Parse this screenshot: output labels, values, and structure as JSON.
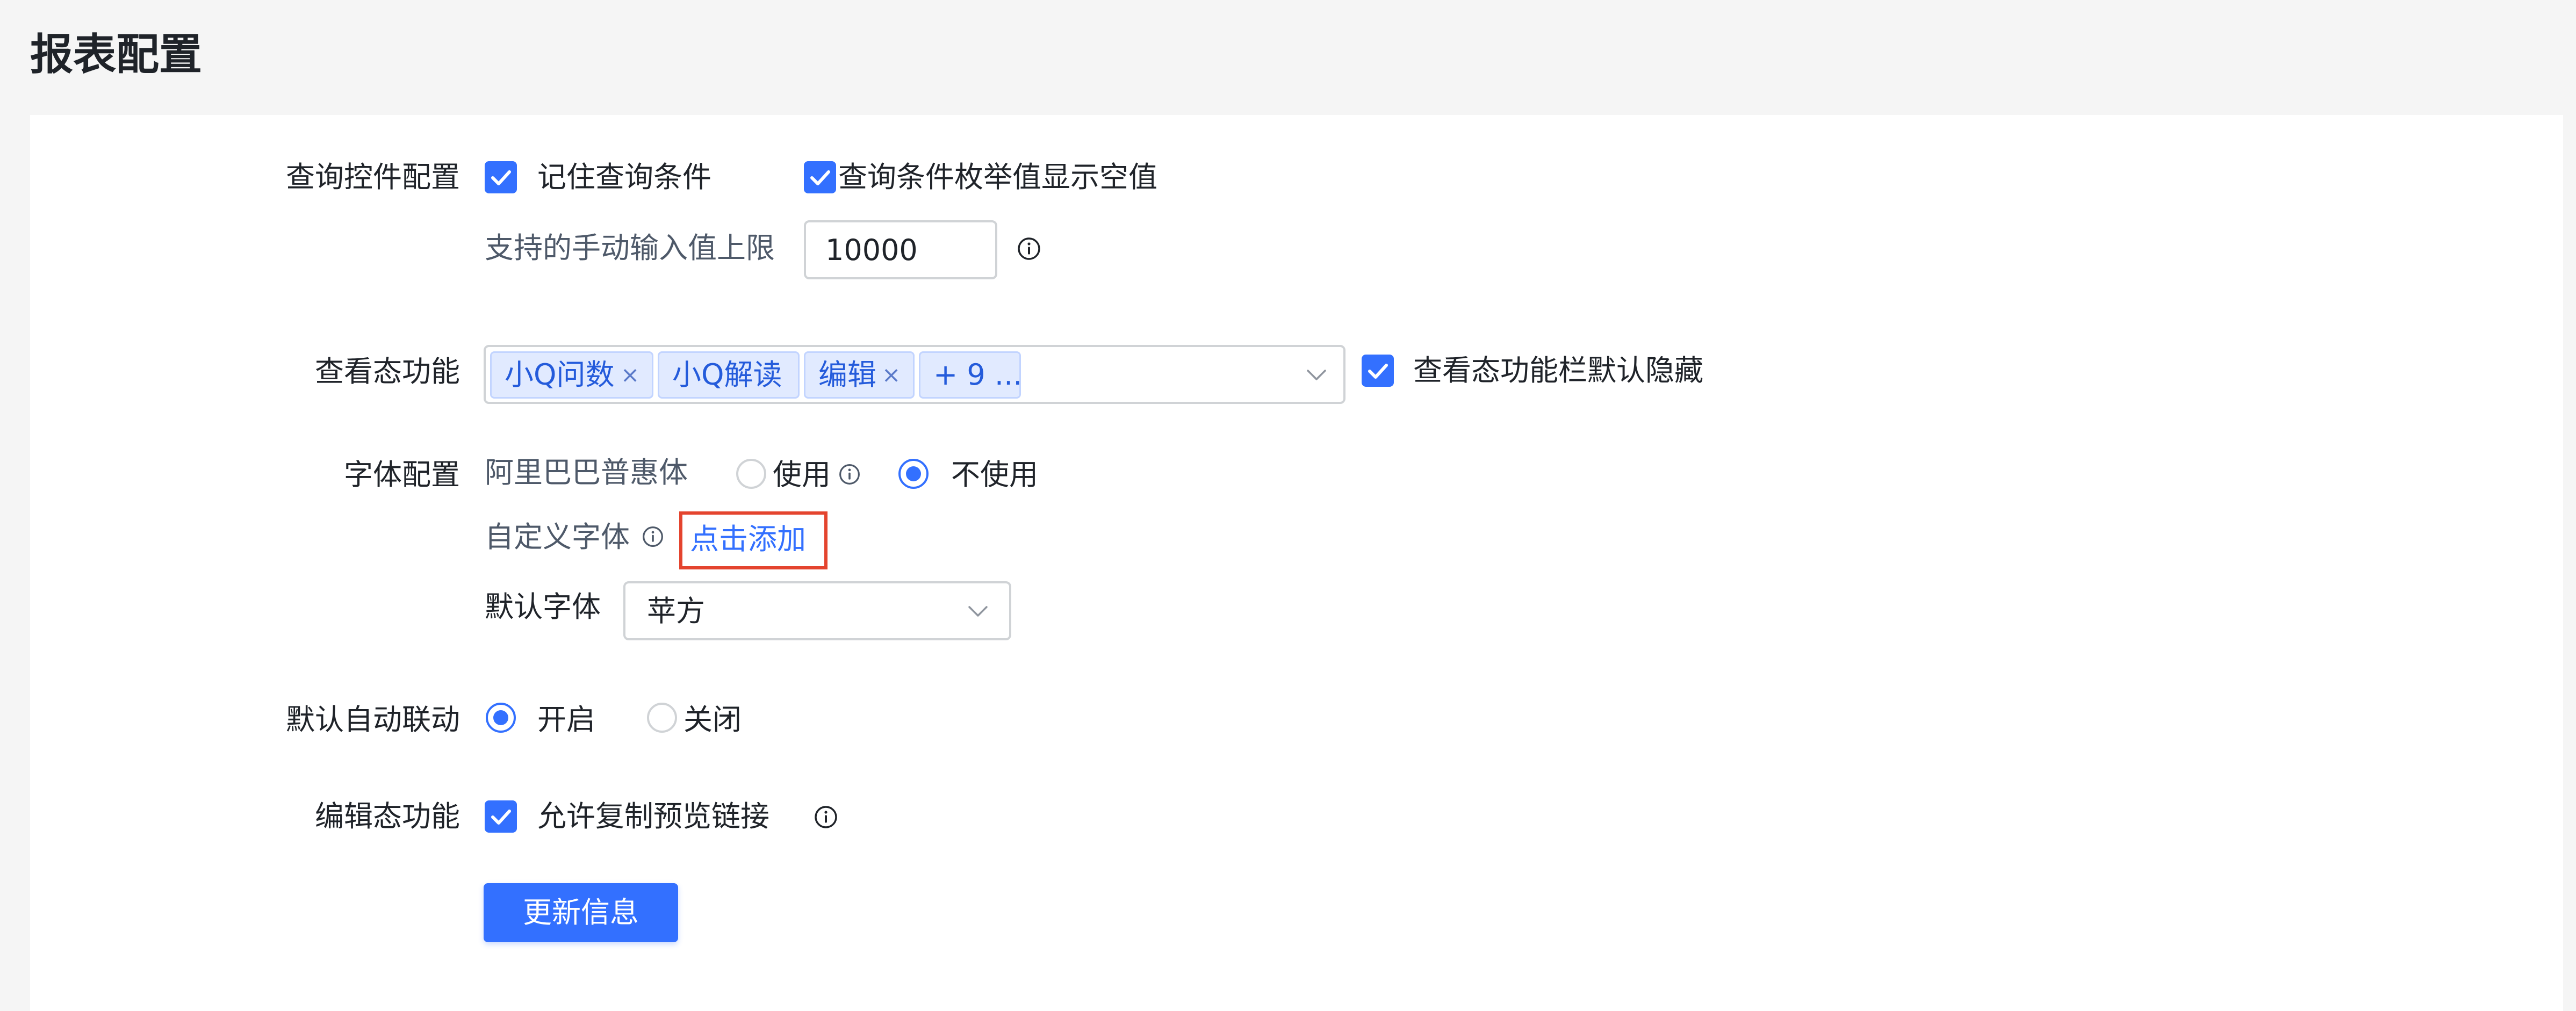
{
  "header": {
    "title": "报表配置"
  },
  "query_controls": {
    "label": "查询控件配置",
    "remember_conditions": {
      "label": "记住查询条件",
      "checked": true
    },
    "show_empty_enum": {
      "label": "查询条件枚举值显示空值",
      "checked": true
    },
    "manual_limit": {
      "label": "支持的手动输入值上限",
      "value": "10000",
      "icon": "info-icon"
    }
  },
  "view_features": {
    "label": "查看态功能",
    "tags": [
      "小Q问数",
      "小Q解读",
      "编辑"
    ],
    "tag_close_glyph": "×",
    "more_tag": "+ 9 ...",
    "hide_toolbar": {
      "label": "查看态功能栏默认隐藏",
      "checked": true
    }
  },
  "font_config": {
    "label": "字体配置",
    "alibaba": {
      "label": "阿里巴巴普惠体",
      "options": [
        "使用",
        "不使用"
      ],
      "selected": "不使用"
    },
    "custom_font": {
      "label": "自定义字体",
      "add_link": "点击添加"
    },
    "default_font": {
      "label": "默认字体",
      "selected": "苹方"
    }
  },
  "auto_linkage": {
    "label": "默认自动联动",
    "options": [
      "开启",
      "关闭"
    ],
    "selected": "开启"
  },
  "edit_features": {
    "label": "编辑态功能",
    "allow_copy_link": {
      "label": "允许复制预览链接",
      "checked": true
    }
  },
  "actions": {
    "update_button": "更新信息"
  },
  "colors": {
    "primary": "#3370ff",
    "highlight_border": "#e4442e",
    "tag_bg": "#e1eaff",
    "page_bg": "#f5f5f5"
  }
}
